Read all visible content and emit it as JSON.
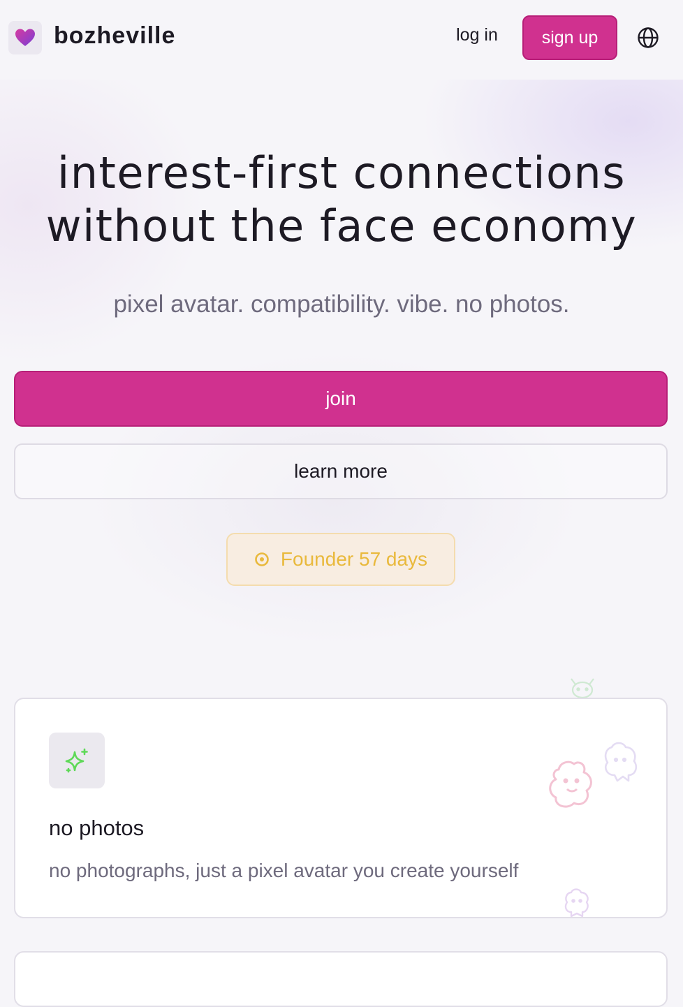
{
  "header": {
    "brand": "bozheville",
    "login_label": "log in",
    "signup_label": "sign up",
    "icons": [
      "heart-icon",
      "globe-icon"
    ]
  },
  "hero": {
    "title_line1": "interest-first connections",
    "title_line2": "without the face economy",
    "subtitle": "pixel avatar. compatibility. vibe. no photos.",
    "join_label": "join",
    "learn_more_label": "learn more",
    "founder_badge": "Founder 57 days"
  },
  "features": [
    {
      "icon": "sparkle-icon",
      "title": "no photos",
      "description": "no photographs, just a pixel avatar you create yourself"
    }
  ],
  "colors": {
    "accent": "#d0318f",
    "badge_text": "#e9b93c",
    "badge_bg": "#f8ede1",
    "sparkle": "#5ed957"
  }
}
